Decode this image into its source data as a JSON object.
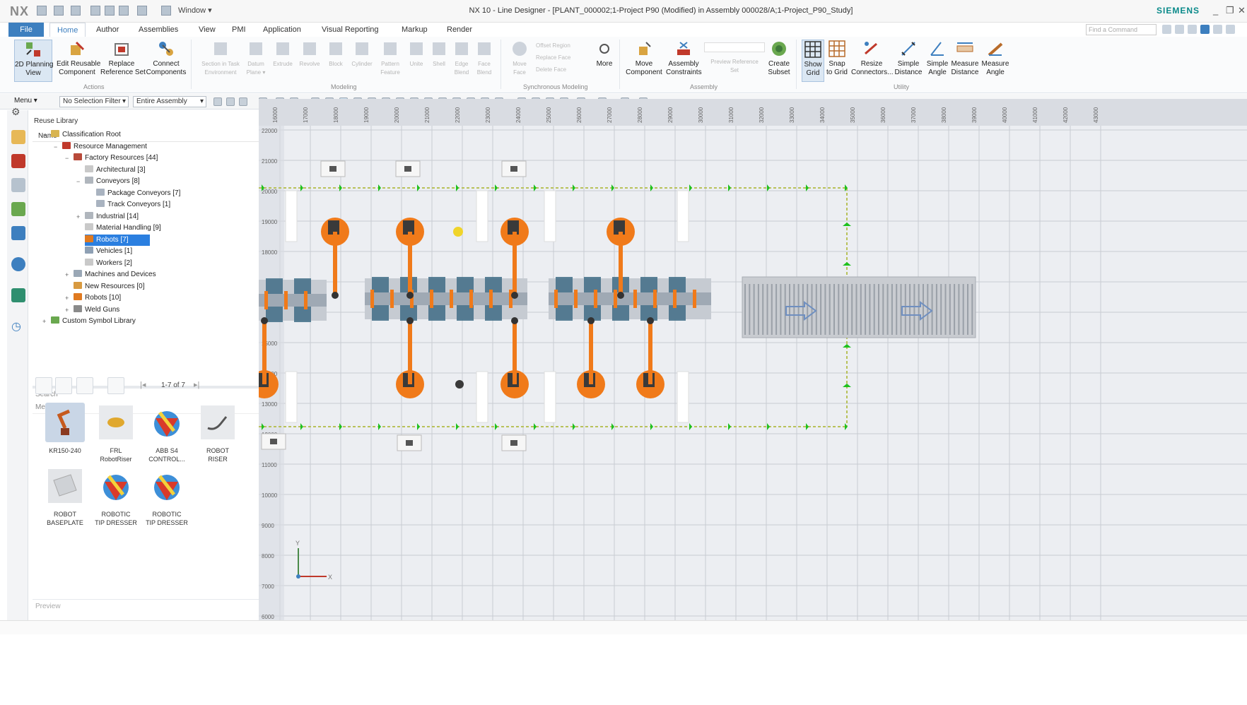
{
  "titlebar": {
    "logo": "NX",
    "window_menu": "Window ▾",
    "title": "NX 10 - Line Designer - [PLANT_000002;1-Project P90 (Modified)  in Assembly 000028/A;1-Project_P90_Study]",
    "brand": "SIEMENS"
  },
  "tabs": {
    "file": "File",
    "items": [
      "Home",
      "Author",
      "Assemblies",
      "View",
      "PMI",
      "Application",
      "Visual Reporting",
      "Markup",
      "Render"
    ],
    "active": "Home",
    "find_command_placeholder": "Find a Command"
  },
  "ribbon": {
    "actions": [
      {
        "label": "2D Planning\nView",
        "icon": "planning-view-icon"
      },
      {
        "label": "Edit Reusable\nComponent",
        "icon": "edit-component-icon"
      },
      {
        "label": "Replace\nReference Set",
        "icon": "replace-reference-icon"
      },
      {
        "label": "Connect\nComponents",
        "icon": "connect-components-icon"
      }
    ],
    "actions_group": "Actions",
    "modeling_dim": [
      "Section in Task\nEnvironment",
      "Datum\nPlane ▾",
      "Extrude",
      "Revolve",
      "Block",
      "Cylinder",
      "Pattern\nFeature",
      "Unite",
      "Shell",
      "Edge\nBlend",
      "Face\nBlend"
    ],
    "modeling_group": "Modeling",
    "sync_items": [
      "Offset Region",
      "Replace Face",
      "Delete Face"
    ],
    "sync_move_face": "Move\nFace",
    "sync_more": "More",
    "sync_group": "Synchronous Modeling",
    "assembly": [
      {
        "label": "Move\nComponent",
        "icon": "move-component-icon"
      },
      {
        "label": "Assembly\nConstraints",
        "icon": "assembly-constraints-icon"
      }
    ],
    "assembly_dim": "Preview Reference\nSet",
    "create_subset": "Create\nSubset",
    "assembly_group": "Assembly",
    "utility": [
      {
        "label": "Show\nGrid",
        "icon": "grid-icon"
      },
      {
        "label": "Snap\nto Grid",
        "icon": "snap-grid-icon"
      },
      {
        "label": "Resize\nConnectors...",
        "icon": "resize-connectors-icon"
      },
      {
        "label": "Simple\nDistance",
        "icon": "simple-distance-icon"
      },
      {
        "label": "Simple\nAngle",
        "icon": "simple-angle-icon"
      },
      {
        "label": "Measure\nDistance",
        "icon": "measure-distance-icon"
      },
      {
        "label": "Measure\nAngle",
        "icon": "measure-angle-icon"
      }
    ],
    "utility_group": "Utility"
  },
  "selection_bar": {
    "menu": "Menu ▾",
    "selection_filter": "No Selection Filter",
    "scope": "Entire Assembly"
  },
  "panel": {
    "title": "Reuse Library",
    "column_header": "Name",
    "tree": [
      {
        "label": "Classification Root",
        "depth": 0,
        "expand": "−",
        "icon_color": "#d8b450"
      },
      {
        "label": "Resource Management",
        "depth": 1,
        "expand": "−",
        "icon_color": "#c0392b"
      },
      {
        "label": "Factory Resources [44]",
        "depth": 2,
        "expand": "−",
        "icon_color": "#b84a3a"
      },
      {
        "label": "Architectural [3]",
        "depth": 3,
        "expand": "",
        "icon_color": "#c9c9c9"
      },
      {
        "label": "Conveyors [8]",
        "depth": 3,
        "expand": "−",
        "icon_color": "#b0b6bd"
      },
      {
        "label": "Package Conveyors [7]",
        "depth": 4,
        "expand": "",
        "icon_color": "#a9b3c0"
      },
      {
        "label": "Track Conveyors [1]",
        "depth": 4,
        "expand": "",
        "icon_color": "#a9b3c0"
      },
      {
        "label": "Industrial [14]",
        "depth": 3,
        "expand": "+",
        "icon_color": "#b0b6bd"
      },
      {
        "label": "Material Handling [9]",
        "depth": 3,
        "expand": "",
        "icon_color": "#c9c9c9"
      },
      {
        "label": "Robots [7]",
        "depth": 3,
        "expand": "",
        "icon_color": "#e07a20",
        "selected": true
      },
      {
        "label": "Vehicles [1]",
        "depth": 3,
        "expand": "",
        "icon_color": "#8ea0b4"
      },
      {
        "label": "Workers [2]",
        "depth": 3,
        "expand": "",
        "icon_color": "#c9c9c9"
      },
      {
        "label": "Machines and Devices",
        "depth": 2,
        "expand": "+",
        "icon_color": "#9aa8b6"
      },
      {
        "label": "New Resources [0]",
        "depth": 2,
        "expand": "",
        "icon_color": "#d89a40"
      },
      {
        "label": "Robots [10]",
        "depth": 2,
        "expand": "+",
        "icon_color": "#e07a20"
      },
      {
        "label": "Weld Guns",
        "depth": 2,
        "expand": "+",
        "icon_color": "#8a8a8a"
      },
      {
        "label": "Custom Symbol Library",
        "depth": 0,
        "expand": "+",
        "icon_color": "#6aa84f"
      }
    ],
    "search_label": "Search",
    "member_select_label": "Member Select",
    "pager": "1-7 of 7",
    "members": [
      {
        "label": "KR150-240",
        "thumb": "robot-arm-thumb",
        "selected": true
      },
      {
        "label": "FRL\nRobotRiser",
        "thumb": "riser-thumb"
      },
      {
        "label": "ABB S4\nCONTROL...",
        "thumb": "nx-part-thumb"
      },
      {
        "label": "ROBOT\nRISER",
        "thumb": "robot-riser-thumb"
      },
      {
        "label": "ROBOT\nBASEPLATE",
        "thumb": "baseplate-thumb"
      },
      {
        "label": "ROBOTIC\nTIP DRESSER",
        "thumb": "nx-part-thumb"
      },
      {
        "label": "ROBOTIC\nTIP DRESSER",
        "thumb": "nx-part-thumb"
      }
    ],
    "preview_label": "Preview"
  },
  "graphics": {
    "x_ruler": [
      "16000",
      "17000",
      "18000",
      "19000",
      "20000",
      "21000",
      "22000",
      "23000",
      "24000",
      "25000",
      "26000",
      "27000",
      "28000",
      "29000",
      "30000",
      "31000",
      "32000",
      "33000",
      "34000",
      "35000",
      "36000",
      "37000",
      "38000",
      "39000",
      "40000",
      "41000",
      "42000",
      "43000"
    ],
    "y_ruler": [
      "22000",
      "21000",
      "20000",
      "19000",
      "18000",
      "17000",
      "16000",
      "15000",
      "14000",
      "13000",
      "12000",
      "11000",
      "10000",
      "9000",
      "8000",
      "7000",
      "6000"
    ],
    "triad_x": "X",
    "triad_y": "Y",
    "colors": {
      "robot": "#f07a1a",
      "conveyor": "#3f6c86",
      "line_green": "#1ec11e",
      "grid": "#c8ccd2"
    }
  }
}
